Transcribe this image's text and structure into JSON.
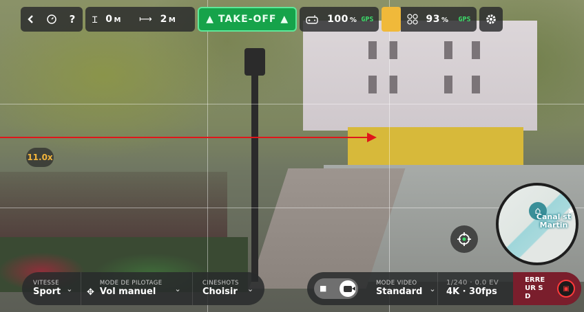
{
  "topbar": {
    "altitude": {
      "value": "0",
      "unit": "M"
    },
    "distance": {
      "value": "2",
      "unit": "M"
    },
    "takeoff_label": "▲ TAKE-OFF ▲",
    "controller_battery": "100",
    "controller_battery_unit": "%",
    "controller_gps": "GPS",
    "drone_battery": "93",
    "drone_battery_unit": "%",
    "drone_gps": "GPS",
    "help_label": "?"
  },
  "zoom": "11.0x",
  "map": {
    "label": "Canal st Martin"
  },
  "bottom_left": {
    "speed": {
      "label": "VITESSE",
      "value": "Sport"
    },
    "piloting": {
      "label": "MODE DE PILOTAGE",
      "value": "Vol manuel"
    },
    "cineshots": {
      "label": "CINESHOTS",
      "value": "Choisir"
    }
  },
  "bottom_right": {
    "video_mode": {
      "label": "MODE VIDEO",
      "value": "Standard"
    },
    "exposure": {
      "label": "1/240 · 0.0 EV",
      "value": "4K · 30fps"
    },
    "error": "ERREUR SD"
  },
  "colors": {
    "takeoff_green": "#16a34a",
    "gps_green": "#3ddc6b",
    "warn_orange": "#f3b53b",
    "error_red": "#7a1e2c",
    "arrow_red": "#e0161a"
  }
}
